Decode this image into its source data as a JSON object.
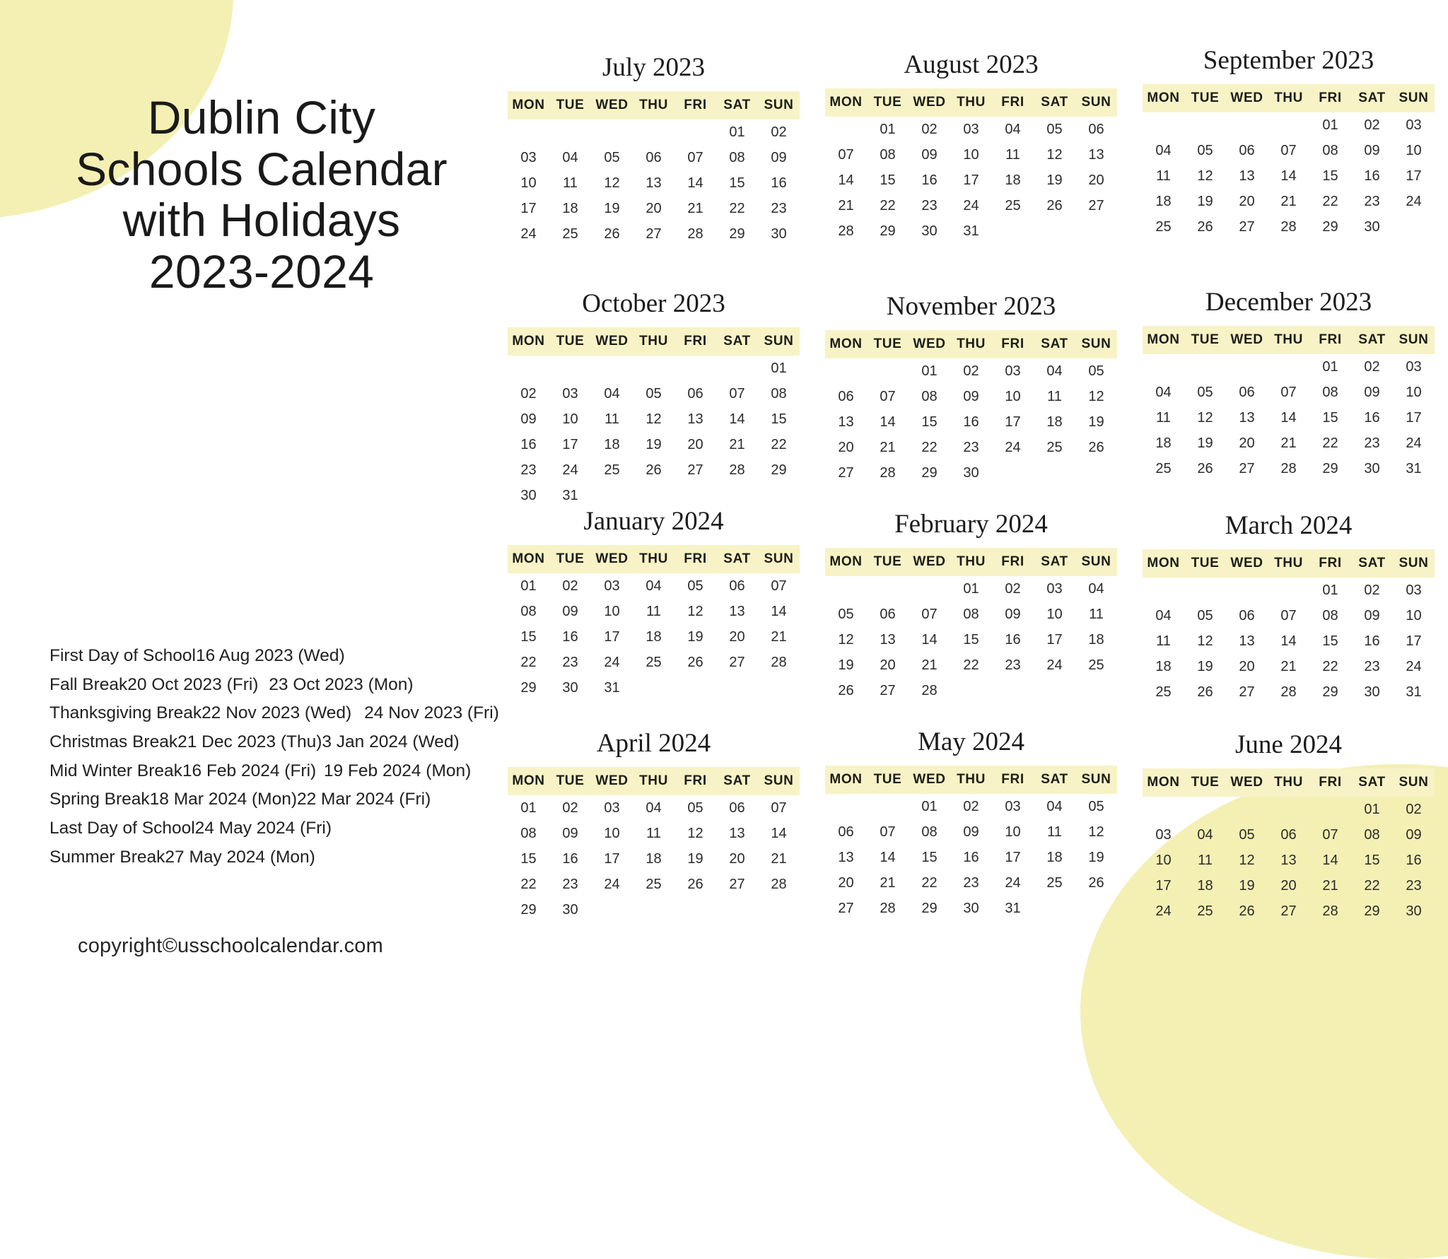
{
  "title": "Dublin City\nSchools Calendar\nwith Holidays\n2023-2024",
  "copyright": "copyright©usschoolcalendar.com",
  "colors": {
    "header_band": "#f7f3c6",
    "decor_blob": "#f4f0b4",
    "text": "#1f1f1f"
  },
  "weekday_headers": [
    "MON",
    "TUE",
    "WED",
    "THU",
    "FRI",
    "SAT",
    "SUN"
  ],
  "holidays": [
    {
      "name": "First Day of School",
      "start": "16 Aug 2023 (Wed)",
      "end": ""
    },
    {
      "name": "Fall Break",
      "start": "20 Oct 2023 (Fri)",
      "end": "23 Oct 2023 (Mon)"
    },
    {
      "name": "Thanksgiving Break",
      "start": "22 Nov 2023 (Wed)",
      "end": "24 Nov 2023 (Fri)"
    },
    {
      "name": "Christmas Break",
      "start": "21 Dec 2023 (Thu)",
      "end": "3 Jan 2024 (Wed)"
    },
    {
      "name": "Mid Winter Break",
      "start": "16 Feb 2024 (Fri)",
      "end": "19 Feb 2024 (Mon)"
    },
    {
      "name": "Spring Break",
      "start": "18 Mar 2024 (Mon)",
      "end": "22 Mar 2024 (Fri)"
    },
    {
      "name": "Last Day of School",
      "start": "24 May 2024 (Fri)",
      "end": ""
    },
    {
      "name": "Summer Break",
      "start": "27 May 2024 (Mon)",
      "end": ""
    }
  ],
  "months": [
    {
      "name": "July 2023",
      "lead_blanks": 5,
      "days": [
        "01",
        "02",
        "03",
        "04",
        "05",
        "06",
        "07",
        "08",
        "09",
        "10",
        "11",
        "12",
        "13",
        "14",
        "15",
        "16",
        "17",
        "18",
        "19",
        "20",
        "21",
        "22",
        "23",
        "24",
        "25",
        "26",
        "27",
        "28",
        "29",
        "30"
      ]
    },
    {
      "name": "August 2023",
      "lead_blanks": 1,
      "days": [
        "01",
        "02",
        "03",
        "04",
        "05",
        "06",
        "07",
        "08",
        "09",
        "10",
        "11",
        "12",
        "13",
        "14",
        "15",
        "16",
        "17",
        "18",
        "19",
        "20",
        "21",
        "22",
        "23",
        "24",
        "25",
        "26",
        "27",
        "28",
        "29",
        "30",
        "31"
      ]
    },
    {
      "name": "September 2023",
      "lead_blanks": 4,
      "days": [
        "01",
        "02",
        "03",
        "04",
        "05",
        "06",
        "07",
        "08",
        "09",
        "10",
        "11",
        "12",
        "13",
        "14",
        "15",
        "16",
        "17",
        "18",
        "19",
        "20",
        "21",
        "22",
        "23",
        "24",
        "25",
        "26",
        "27",
        "28",
        "29",
        "30"
      ]
    },
    {
      "name": "October 2023",
      "lead_blanks": 6,
      "days": [
        "01",
        "02",
        "03",
        "04",
        "05",
        "06",
        "07",
        "08",
        "09",
        "10",
        "11",
        "12",
        "13",
        "14",
        "15",
        "16",
        "17",
        "18",
        "19",
        "20",
        "21",
        "22",
        "23",
        "24",
        "25",
        "26",
        "27",
        "28",
        "29",
        "30",
        "31"
      ]
    },
    {
      "name": "November 2023",
      "lead_blanks": 2,
      "days": [
        "01",
        "02",
        "03",
        "04",
        "05",
        "06",
        "07",
        "08",
        "09",
        "10",
        "11",
        "12",
        "13",
        "14",
        "15",
        "16",
        "17",
        "18",
        "19",
        "20",
        "21",
        "22",
        "23",
        "24",
        "25",
        "26",
        "27",
        "28",
        "29",
        "30"
      ]
    },
    {
      "name": "December 2023",
      "lead_blanks": 4,
      "days": [
        "01",
        "02",
        "03",
        "04",
        "05",
        "06",
        "07",
        "08",
        "09",
        "10",
        "11",
        "12",
        "13",
        "14",
        "15",
        "16",
        "17",
        "18",
        "19",
        "20",
        "21",
        "22",
        "23",
        "24",
        "25",
        "26",
        "27",
        "28",
        "29",
        "30",
        "31"
      ]
    },
    {
      "name": "January 2024",
      "lead_blanks": 0,
      "days": [
        "01",
        "02",
        "03",
        "04",
        "05",
        "06",
        "07",
        "08",
        "09",
        "10",
        "11",
        "12",
        "13",
        "14",
        "15",
        "16",
        "17",
        "18",
        "19",
        "20",
        "21",
        "22",
        "23",
        "24",
        "25",
        "26",
        "27",
        "28",
        "29",
        "30",
        "31"
      ]
    },
    {
      "name": "February 2024",
      "lead_blanks": 3,
      "days": [
        "01",
        "02",
        "03",
        "04",
        "05",
        "06",
        "07",
        "08",
        "09",
        "10",
        "11",
        "12",
        "13",
        "14",
        "15",
        "16",
        "17",
        "18",
        "19",
        "20",
        "21",
        "22",
        "23",
        "24",
        "25",
        "26",
        "27",
        "28"
      ]
    },
    {
      "name": "March 2024",
      "lead_blanks": 4,
      "days": [
        "01",
        "02",
        "03",
        "04",
        "05",
        "06",
        "07",
        "08",
        "09",
        "10",
        "11",
        "12",
        "13",
        "14",
        "15",
        "16",
        "17",
        "18",
        "19",
        "20",
        "21",
        "22",
        "23",
        "24",
        "25",
        "26",
        "27",
        "28",
        "29",
        "30",
        "31"
      ]
    },
    {
      "name": "April 2024",
      "lead_blanks": 0,
      "days": [
        "01",
        "02",
        "03",
        "04",
        "05",
        "06",
        "07",
        "08",
        "09",
        "10",
        "11",
        "12",
        "13",
        "14",
        "15",
        "16",
        "17",
        "18",
        "19",
        "20",
        "21",
        "22",
        "23",
        "24",
        "25",
        "26",
        "27",
        "28",
        "29",
        "30"
      ]
    },
    {
      "name": "May 2024",
      "lead_blanks": 2,
      "days": [
        "01",
        "02",
        "03",
        "04",
        "05",
        "06",
        "07",
        "08",
        "09",
        "10",
        "11",
        "12",
        "13",
        "14",
        "15",
        "16",
        "17",
        "18",
        "19",
        "20",
        "21",
        "22",
        "23",
        "24",
        "25",
        "26",
        "27",
        "28",
        "29",
        "30",
        "31"
      ]
    },
    {
      "name": "June 2024",
      "lead_blanks": 5,
      "days": [
        "01",
        "02",
        "03",
        "04",
        "05",
        "06",
        "07",
        "08",
        "09",
        "10",
        "11",
        "12",
        "13",
        "14",
        "15",
        "16",
        "17",
        "18",
        "19",
        "20",
        "21",
        "22",
        "23",
        "24",
        "25",
        "26",
        "27",
        "28",
        "29",
        "30"
      ]
    }
  ]
}
